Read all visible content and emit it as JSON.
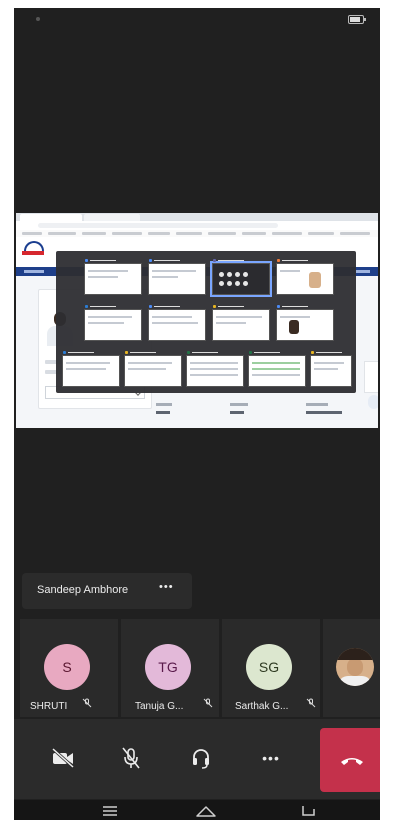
{
  "call": {
    "speaker_name": "Sandeep Ambhore",
    "speaker_more": "•••",
    "participants": [
      {
        "initials": "S",
        "name": "SHRUTI",
        "bg": "#e8a9c1",
        "fg": "#5a1730"
      },
      {
        "initials": "TG",
        "name": "Tanuja G...",
        "bg": "#e3b9d9",
        "fg": "#5a1a4b"
      },
      {
        "initials": "SG",
        "name": "Sarthak G...",
        "bg": "#dce7cf",
        "fg": "#2f3b22"
      }
    ],
    "controls": {
      "camera": "camera-off-icon",
      "mic": "mic-off-icon",
      "audio": "headset-icon",
      "more": "•••",
      "hangup": "hang-up-icon"
    }
  },
  "colors": {
    "background": "#202020",
    "tile": "#2a2a2a",
    "hangup": "#c4314b"
  }
}
